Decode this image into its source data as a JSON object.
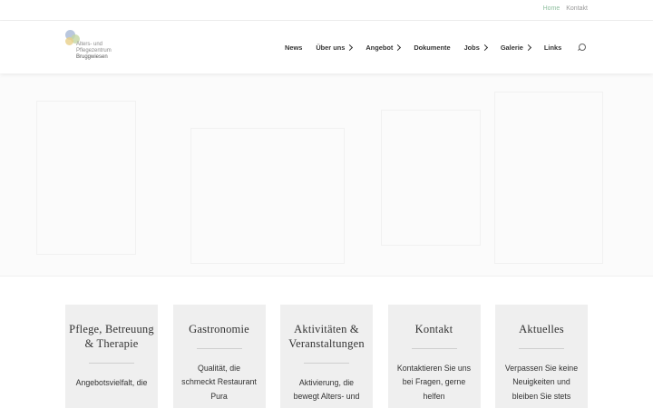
{
  "topbar": {
    "links": [
      "Home",
      "Kontakt"
    ]
  },
  "logo": {
    "line1": "Alters- und",
    "line2": "Pflegezentrum",
    "line3": "Bruggwiesen"
  },
  "nav": {
    "items": [
      {
        "label": "News"
      },
      {
        "label": "Über uns"
      },
      {
        "label": "Angebot"
      },
      {
        "label": "Dokumente"
      },
      {
        "label": "Jobs"
      },
      {
        "label": "Galerie"
      },
      {
        "label": "Links"
      }
    ],
    "search_icon": "search-icon"
  },
  "cards": [
    {
      "title": "Pflege, Betreuung & Therapie",
      "body": "Angebotsvielfalt, die"
    },
    {
      "title": "Gastronomie",
      "body": "Qualität, die schmeckt Restaurant Pura"
    },
    {
      "title": "Aktivitäten & Veranstaltungen",
      "body": "Aktivierung, die bewegt Alters- und"
    },
    {
      "title": "Kontakt",
      "body": "Kontaktieren Sie uns bei Fragen, gerne helfen"
    },
    {
      "title": "Aktuelles",
      "body": "Verpassen Sie keine Neuigkeiten und bleiben Sie stets"
    }
  ],
  "colors": {
    "accent": "#8fbf9f",
    "card_bg": "#efefef"
  }
}
